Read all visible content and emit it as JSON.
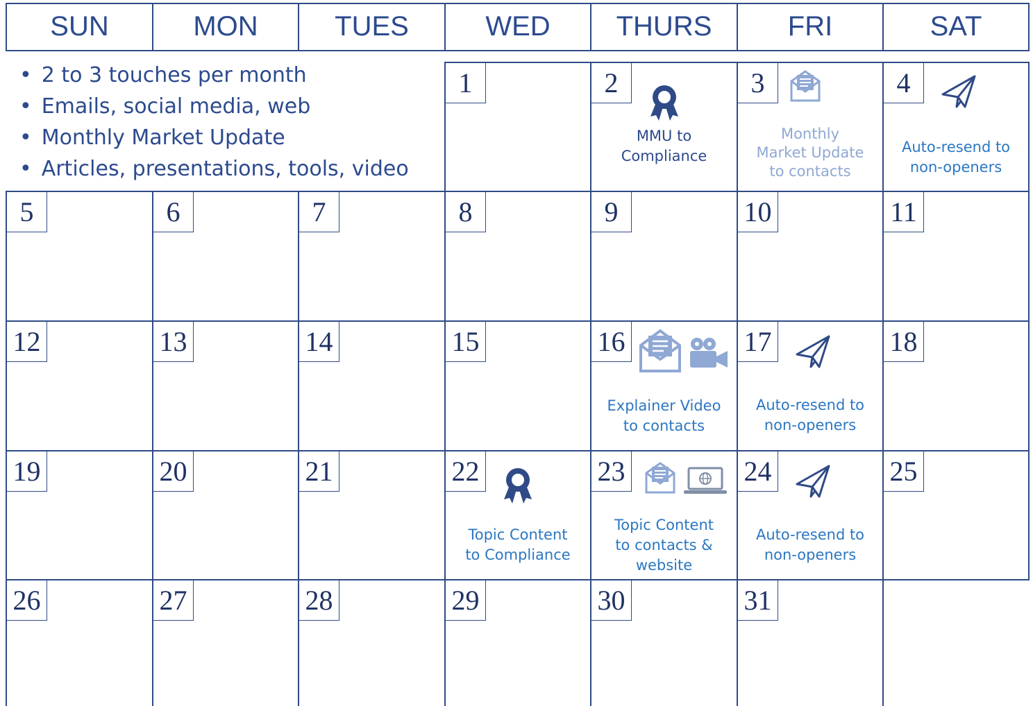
{
  "headers": [
    "SUN",
    "MON",
    "TUES",
    "WED",
    "THURS",
    "FRI",
    "SAT"
  ],
  "bullets": [
    "2 to 3 touches per month",
    "Emails, social media, web",
    "Monthly Market Update",
    "Articles, presentations, tools, video"
  ],
  "days": {
    "d1": "1",
    "d2": "2",
    "d3": "3",
    "d4": "4",
    "d5": "5",
    "d6": "6",
    "d7": "7",
    "d8": "8",
    "d9": "9",
    "d10": "10",
    "d11": "11",
    "d12": "12",
    "d13": "13",
    "d14": "14",
    "d15": "15",
    "d16": "16",
    "d17": "17",
    "d18": "18",
    "d19": "19",
    "d20": "20",
    "d21": "21",
    "d22": "22",
    "d23": "23",
    "d24": "24",
    "d25": "25",
    "d26": "26",
    "d27": "27",
    "d28": "28",
    "d29": "29",
    "d30": "30",
    "d31": "31"
  },
  "notes": {
    "d2": [
      "MMU to",
      "Compliance"
    ],
    "d3": [
      "Monthly",
      "Market Update",
      "to contacts"
    ],
    "d4": [
      "Auto-resend to",
      "non-openers"
    ],
    "d16": [
      "Explainer Video",
      "to contacts"
    ],
    "d17": [
      "Auto-resend to",
      "non-openers"
    ],
    "d22": [
      "Topic Content",
      "to Compliance"
    ],
    "d23": [
      "Topic Content",
      "to contacts &",
      "website"
    ],
    "d24": [
      "Auto-resend to",
      "non-openers"
    ]
  },
  "colors": {
    "grid": "#2f4a86",
    "dark_text": "#2c4a8e",
    "blue_text": "#2b77c2",
    "light_text": "#8fa8d4",
    "icon_dark": "#2f4a86",
    "icon_light": "#8fa8d4"
  },
  "icons": {
    "d2": "award-ribbon-icon",
    "d3": "open-envelope-icon",
    "d4": "paper-plane-icon",
    "d16": [
      "open-envelope-icon",
      "video-camera-icon"
    ],
    "d17": "paper-plane-icon",
    "d22": "award-ribbon-icon",
    "d23": [
      "open-envelope-icon",
      "laptop-globe-icon"
    ],
    "d24": "paper-plane-icon"
  }
}
